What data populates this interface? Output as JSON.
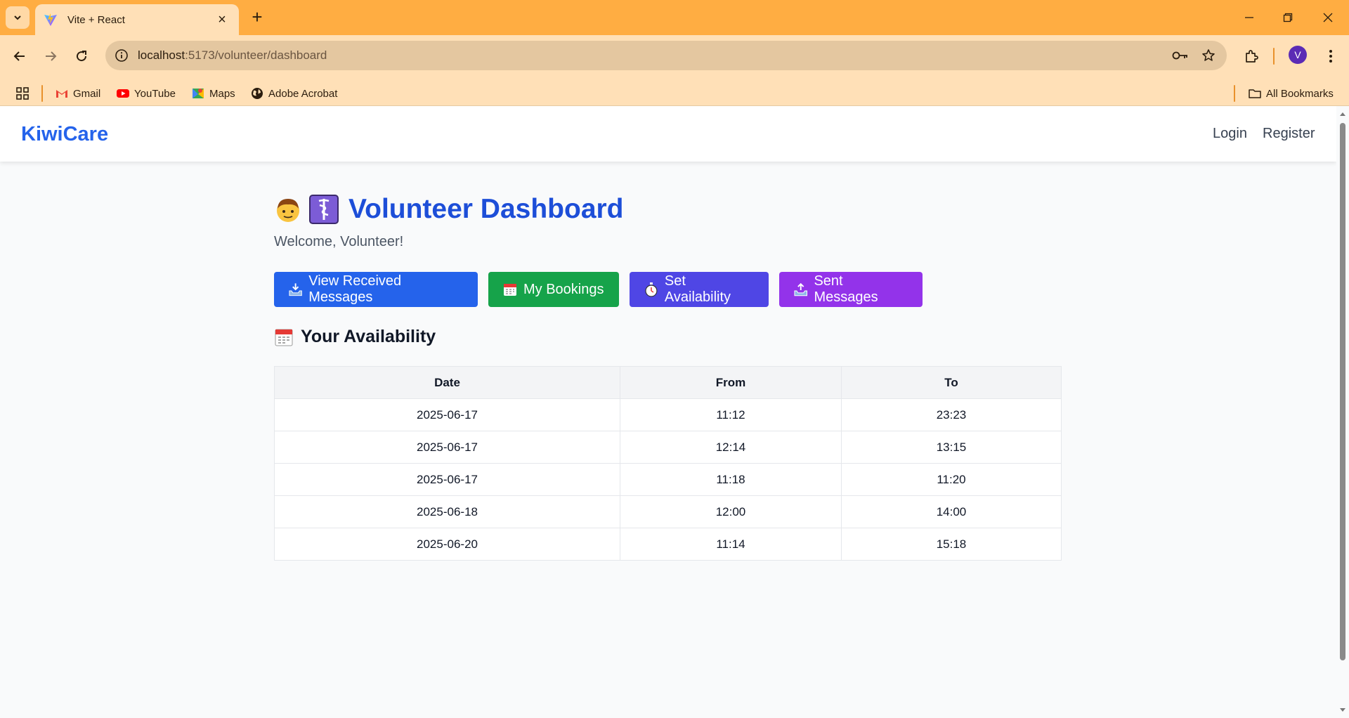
{
  "browser": {
    "tab_title": "Vite + React",
    "url_host": "localhost",
    "url_path": ":5173/volunteer/dashboard",
    "profile_initial": "V",
    "bookmarks": [
      {
        "label": "Gmail",
        "icon": "gmail-icon"
      },
      {
        "label": "YouTube",
        "icon": "youtube-icon"
      },
      {
        "label": "Maps",
        "icon": "maps-icon"
      },
      {
        "label": "Adobe Acrobat",
        "icon": "globe-icon"
      }
    ],
    "all_bookmarks": "All Bookmarks"
  },
  "app": {
    "brand": "KiwiCare",
    "nav": {
      "login": "Login",
      "register": "Register"
    }
  },
  "dashboard": {
    "title": "Volunteer Dashboard",
    "welcome": "Welcome, Volunteer!",
    "buttons": {
      "received": "View Received Messages",
      "bookings": "My Bookings",
      "availability": "Set Availability",
      "sent": "Sent Messages"
    },
    "section_title": "Your Availability",
    "table": {
      "headers": [
        "Date",
        "From",
        "To"
      ],
      "rows": [
        [
          "2025-06-17",
          "11:12",
          "23:23"
        ],
        [
          "2025-06-17",
          "12:14",
          "13:15"
        ],
        [
          "2025-06-17",
          "11:18",
          "11:20"
        ],
        [
          "2025-06-18",
          "12:00",
          "14:00"
        ],
        [
          "2025-06-20",
          "11:14",
          "15:18"
        ]
      ]
    }
  },
  "colors": {
    "brand": "#2563eb",
    "title": "#1d4ed8",
    "btn_blue": "#2563eb",
    "btn_green": "#16a34a",
    "btn_indigo": "#4f46e5",
    "btn_purple": "#9333ea"
  }
}
